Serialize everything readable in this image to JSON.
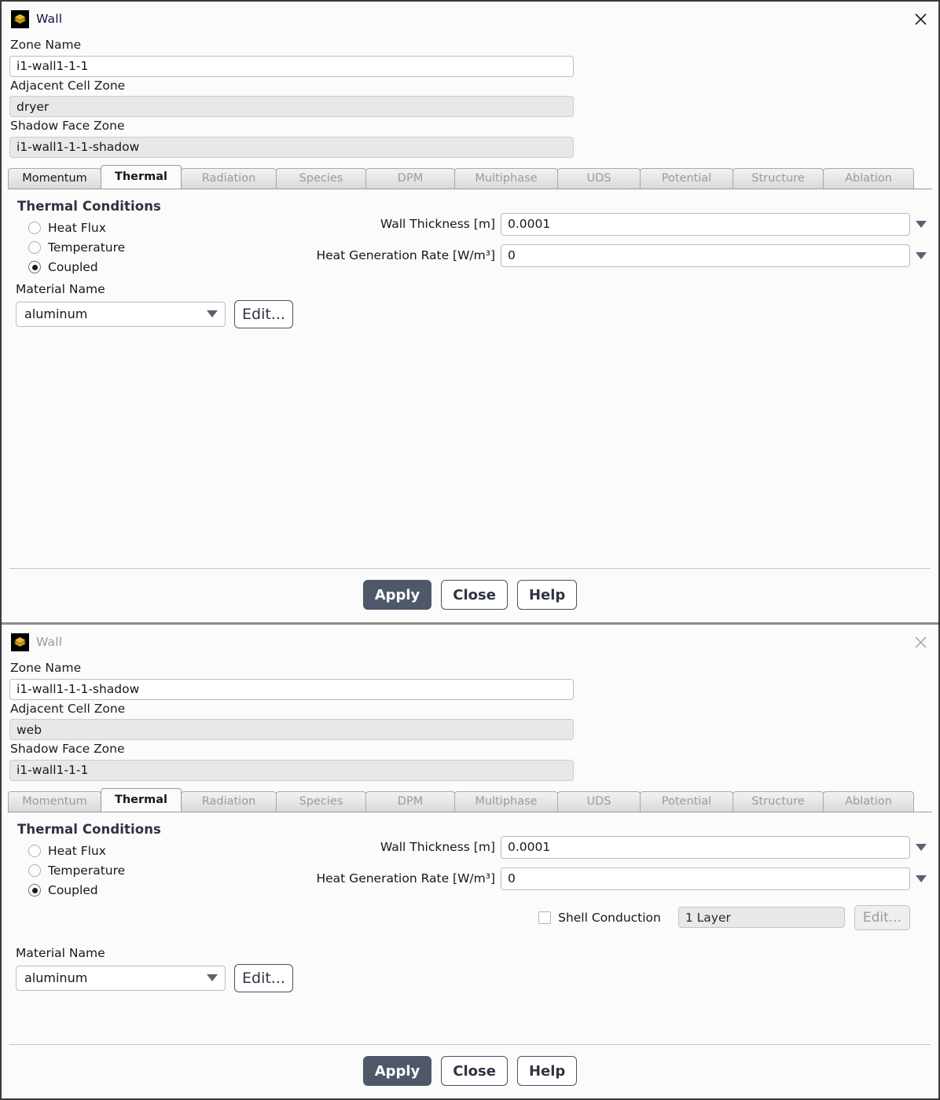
{
  "dialogs": [
    {
      "title": "Wall",
      "icon": "wall-layers-icon",
      "state": "active",
      "close_icon": "close-icon",
      "zone_name_label": "Zone Name",
      "zone_name_value": "i1-wall1-1-1",
      "adjacent_cell_zone_label": "Adjacent Cell Zone",
      "adjacent_cell_zone_value": "dryer",
      "shadow_face_zone_label": "Shadow Face Zone",
      "shadow_face_zone_value": "i1-wall1-1-1-shadow",
      "tabs": [
        {
          "label": "Momentum",
          "state": "enabled"
        },
        {
          "label": "Thermal",
          "state": "active"
        },
        {
          "label": "Radiation",
          "state": "disabled"
        },
        {
          "label": "Species",
          "state": "disabled"
        },
        {
          "label": "DPM",
          "state": "disabled"
        },
        {
          "label": "Multiphase",
          "state": "disabled"
        },
        {
          "label": "UDS",
          "state": "disabled"
        },
        {
          "label": "Potential",
          "state": "disabled"
        },
        {
          "label": "Structure",
          "state": "disabled"
        },
        {
          "label": "Ablation",
          "state": "disabled"
        }
      ],
      "section_title": "Thermal Conditions",
      "thermal_options": [
        {
          "label": "Heat Flux",
          "selected": false
        },
        {
          "label": "Temperature",
          "selected": false
        },
        {
          "label": "Coupled",
          "selected": true
        }
      ],
      "wall_thickness_label": "Wall Thickness [m]",
      "wall_thickness_value": "0.0001",
      "heat_generation_label": "Heat Generation Rate [W/m³]",
      "heat_generation_value": "0",
      "has_shell_conduction": false,
      "material_label": "Material Name",
      "material_value": "aluminum",
      "material_edit_label": "Edit...",
      "buttons": {
        "apply": "Apply",
        "close": "Close",
        "help": "Help"
      }
    },
    {
      "title": "Wall",
      "icon": "wall-layers-icon",
      "state": "inactive",
      "close_icon": "close-icon",
      "zone_name_label": "Zone Name",
      "zone_name_value": "i1-wall1-1-1-shadow",
      "adjacent_cell_zone_label": "Adjacent Cell Zone",
      "adjacent_cell_zone_value": "web",
      "shadow_face_zone_label": "Shadow Face Zone",
      "shadow_face_zone_value": "i1-wall1-1-1",
      "tabs": [
        {
          "label": "Momentum",
          "state": "disabled"
        },
        {
          "label": "Thermal",
          "state": "active"
        },
        {
          "label": "Radiation",
          "state": "disabled"
        },
        {
          "label": "Species",
          "state": "disabled"
        },
        {
          "label": "DPM",
          "state": "disabled"
        },
        {
          "label": "Multiphase",
          "state": "disabled"
        },
        {
          "label": "UDS",
          "state": "disabled"
        },
        {
          "label": "Potential",
          "state": "disabled"
        },
        {
          "label": "Structure",
          "state": "disabled"
        },
        {
          "label": "Ablation",
          "state": "disabled"
        }
      ],
      "section_title": "Thermal Conditions",
      "thermal_options": [
        {
          "label": "Heat Flux",
          "selected": false
        },
        {
          "label": "Temperature",
          "selected": false
        },
        {
          "label": "Coupled",
          "selected": true
        }
      ],
      "wall_thickness_label": "Wall Thickness [m]",
      "wall_thickness_value": "0.0001",
      "heat_generation_label": "Heat Generation Rate [W/m³]",
      "heat_generation_value": "0",
      "has_shell_conduction": true,
      "shell_conduction_label": "Shell Conduction",
      "shell_conduction_checked": false,
      "shell_layer_value": "1 Layer",
      "shell_edit_label": "Edit...",
      "material_label": "Material Name",
      "material_value": "aluminum",
      "material_edit_label": "Edit...",
      "buttons": {
        "apply": "Apply",
        "close": "Close",
        "help": "Help"
      }
    }
  ],
  "colors": {
    "accent": "#4e5868",
    "border": "#4a5163",
    "section_heading": "#2e3340",
    "icon_gold": "#d4a017"
  }
}
